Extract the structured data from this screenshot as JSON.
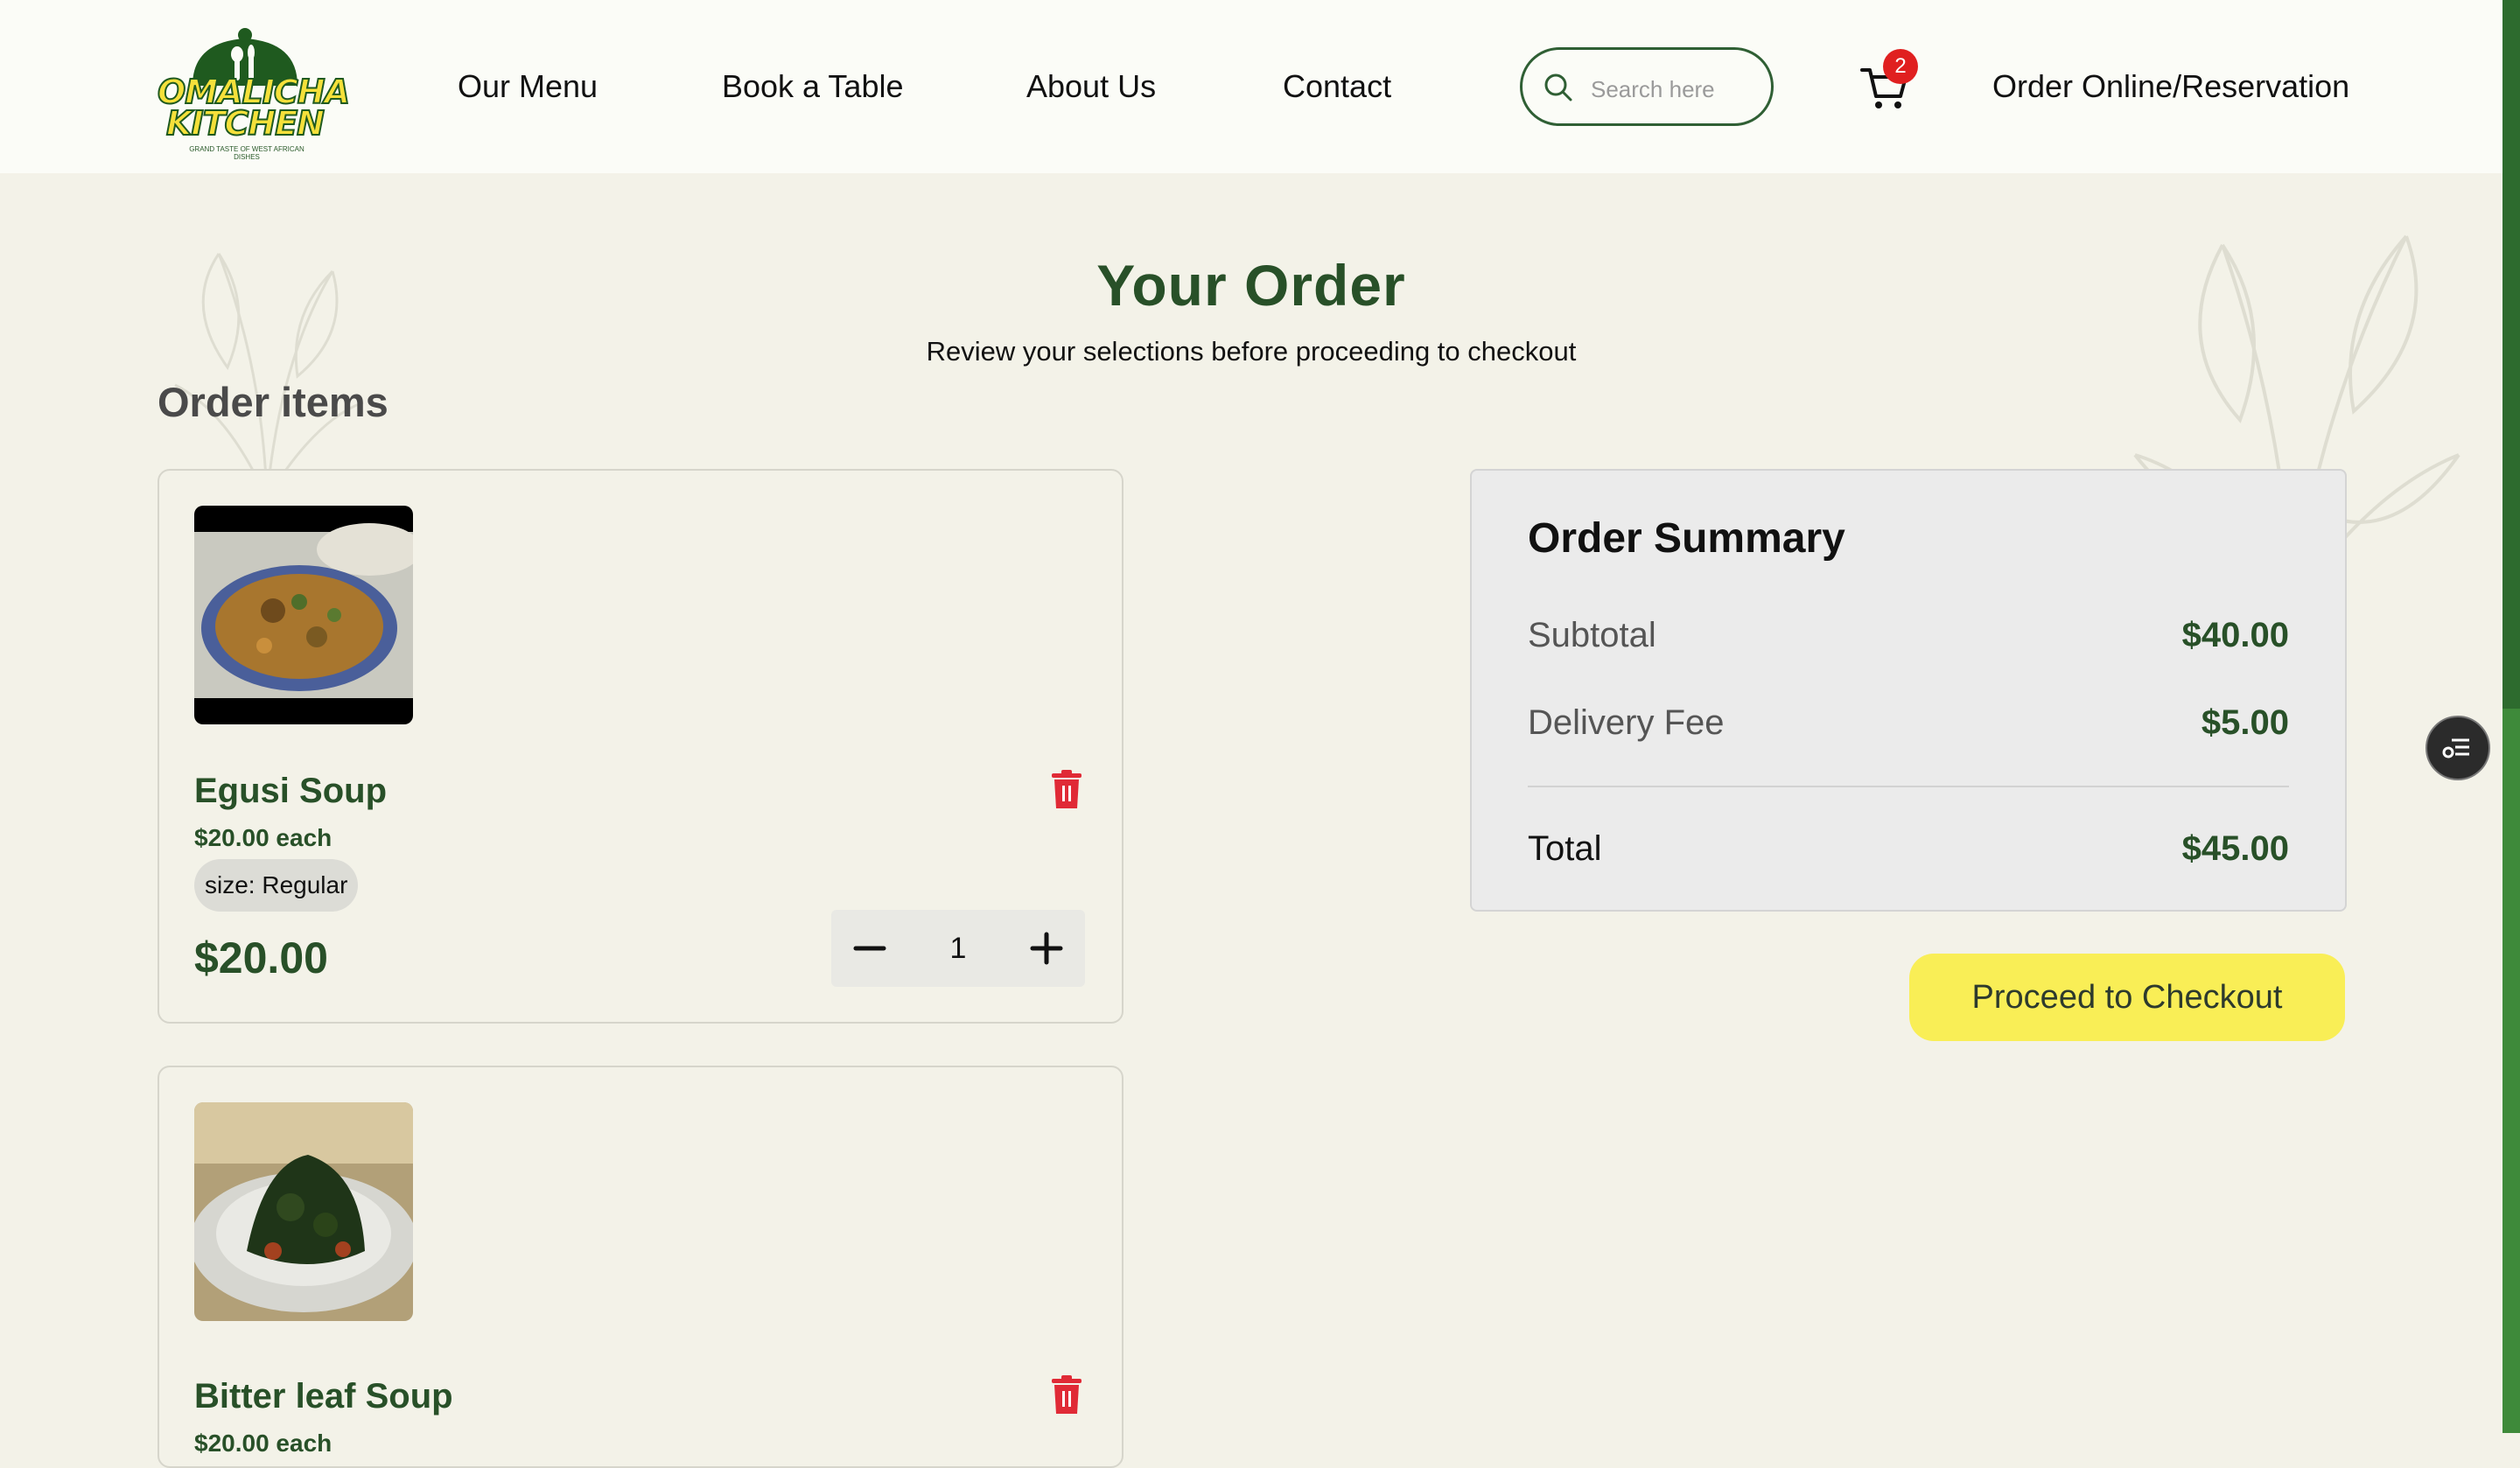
{
  "brand": {
    "name_line1": "OMALICHA",
    "name_line2": "KITCHEN",
    "tagline": "GRAND TASTE OF WEST AFRICAN DISHES"
  },
  "nav": {
    "links": [
      "Our Menu",
      "Book a Table",
      "About Us",
      "Contact"
    ],
    "search_placeholder": "Search here",
    "cart_count": "2",
    "order_link": "Order Online/Reservation"
  },
  "page": {
    "title": "Your Order",
    "subtitle": "Review your selections before proceeding to checkout",
    "section_title": "Order items"
  },
  "items": [
    {
      "name": "Egusi Soup",
      "each": "$20.00 each",
      "option": "size: Regular",
      "total": "$20.00",
      "quantity": "1"
    },
    {
      "name": "Bitter leaf Soup",
      "each": "$20.00 each"
    }
  ],
  "summary": {
    "title": "Order Summary",
    "subtotal_label": "Subtotal",
    "subtotal": "$40.00",
    "delivery_label": "Delivery Fee",
    "delivery": "$5.00",
    "total_label": "Total",
    "total": "$45.00"
  },
  "checkout_label": "Proceed to Checkout",
  "colors": {
    "brand_green": "#285028",
    "accent_yellow": "#f9ee56",
    "danger_red": "#e02020"
  },
  "icons": [
    "search-icon",
    "cart-icon",
    "trash-icon",
    "minus-icon",
    "plus-icon",
    "menu-list-icon"
  ]
}
